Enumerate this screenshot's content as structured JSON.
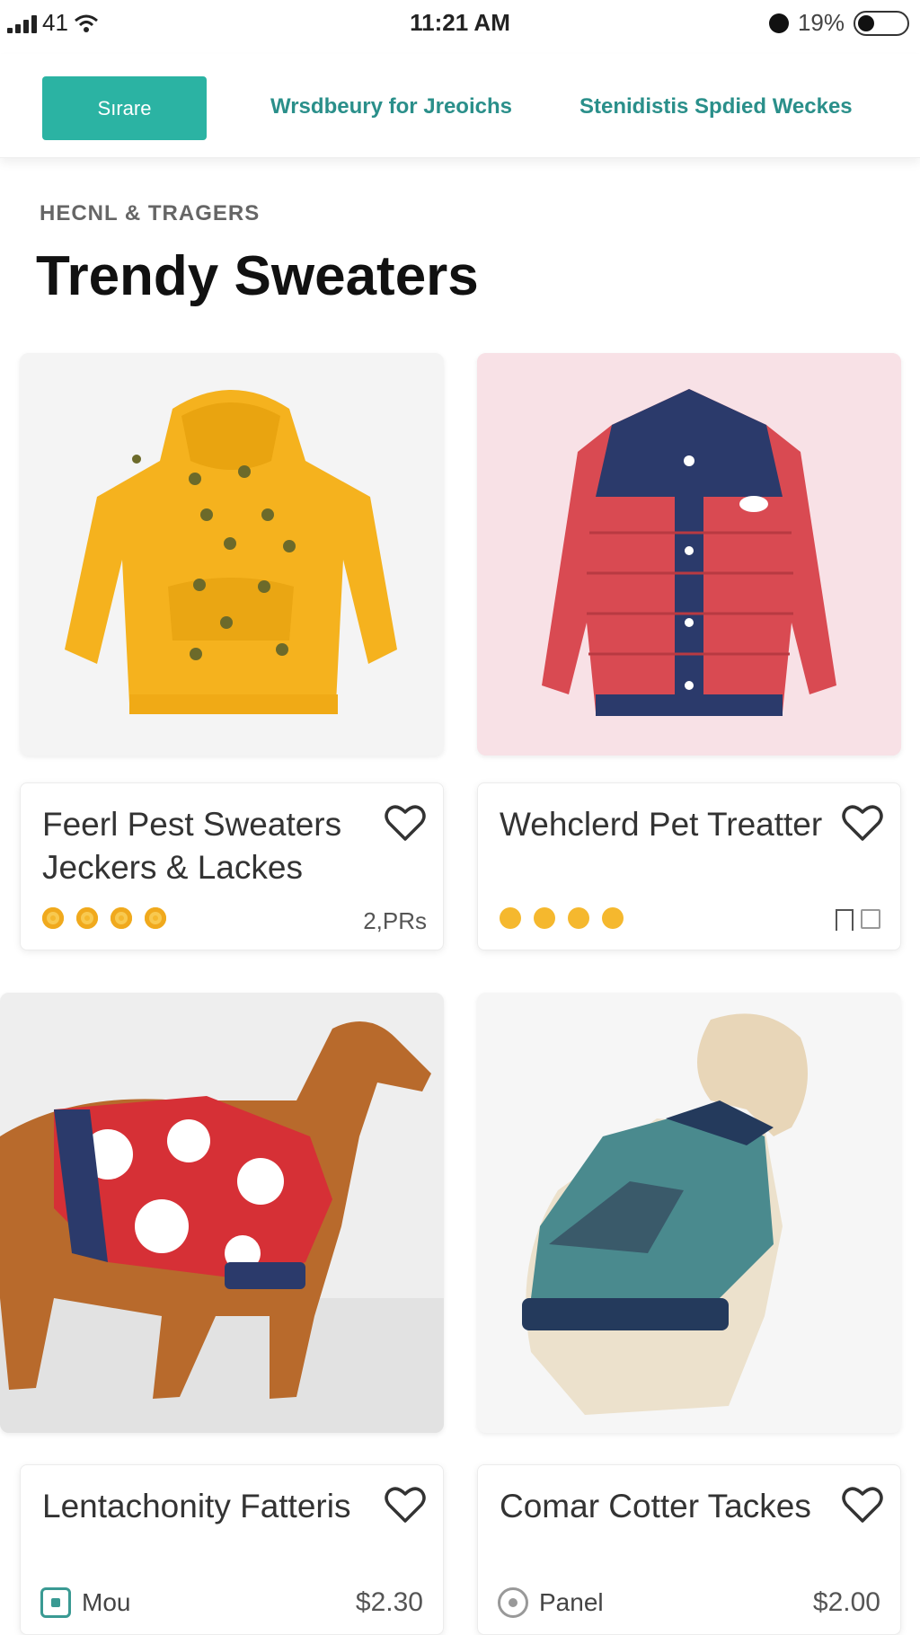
{
  "status_bar": {
    "signal_text": "41",
    "time": "11:21 AM",
    "battery_text": "19%"
  },
  "nav": {
    "store_label": "Sırare",
    "link_1": "Wrsdbeury for Jreoichs",
    "link_2": "Stenidistis  Spdied Weckes"
  },
  "section": {
    "eyebrow": "HECNL & TRAGERS",
    "title": "Trendy Sweaters"
  },
  "products": [
    {
      "title": "Feerl Pest Sweaters Jeckers & Lackes",
      "rating_dots": 4,
      "meta": "2,PRs",
      "image": "yellow-hoodie"
    },
    {
      "title": "Wehclerd Pet Treatter",
      "rating_dots": 4,
      "meta_icon": "bookmark-icon",
      "image": "red-navy-puffer-jacket"
    },
    {
      "title": "Lentachonity Fatteris",
      "badge": "Mou",
      "price": "$2.30",
      "image": "dog-in-red-vest"
    },
    {
      "title": "Comar Cotter Tackes",
      "badge": "Panel",
      "price": "$2.00",
      "image": "dog-in-teal-jacket"
    }
  ],
  "colors": {
    "accent": "#2bb3a3",
    "link": "#2a8f8a",
    "rating": "#f5b82e"
  }
}
